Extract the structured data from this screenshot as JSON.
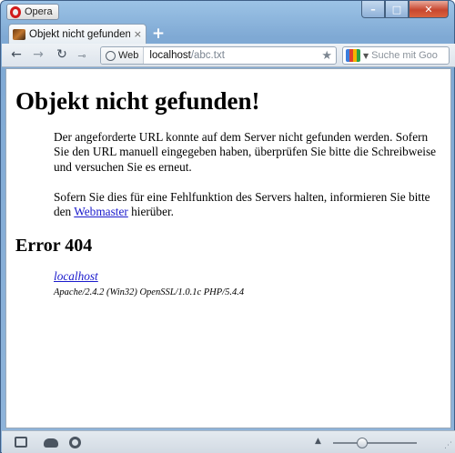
{
  "app": {
    "menu_label": "Opera",
    "controls": {
      "minimize": "–",
      "maximize": "□",
      "close": "✕"
    }
  },
  "tabs": [
    {
      "title": "Objekt nicht gefunden!",
      "close_glyph": "×",
      "active": true
    }
  ],
  "new_tab_glyph": "+",
  "toolbar": {
    "back_glyph": "←",
    "forward_glyph": "→",
    "reload_glyph": "↻",
    "key_glyph": "⊸",
    "web_badge": "Web",
    "url_host": "localhost",
    "url_path": "/abc.txt",
    "bookmark_glyph": "★",
    "search_placeholder": "Suche mit Goo"
  },
  "page": {
    "heading": "Objekt nicht gefunden!",
    "paragraph1": "Der angeforderte URL konnte auf dem Server nicht gefunden werden. Sofern Sie den URL manuell eingegeben haben, überprüfen Sie bitte die Schreibweise und versuchen Sie es erneut.",
    "paragraph2_before": "Sofern Sie dies für eine Fehlfunktion des Servers halten, informieren Sie bitte den ",
    "paragraph2_link": "Webmaster",
    "paragraph2_after": " hierüber.",
    "error_heading": "Error 404",
    "address_link": "localhost",
    "server_signature": "Apache/2.4.2 (Win32) OpenSSL/1.0.1c PHP/5.4.4"
  },
  "statusbar": {
    "icons": [
      "panel-toggle-icon",
      "opera-link-icon",
      "turbo-icon"
    ],
    "zoom_caret": "▲",
    "zoom_level_fraction": 0.35,
    "grip_glyph": "⋰"
  },
  "colors": {
    "link": "#1a1acc",
    "close_button": "#c8472f",
    "opera_brand": "#d11a1a"
  }
}
